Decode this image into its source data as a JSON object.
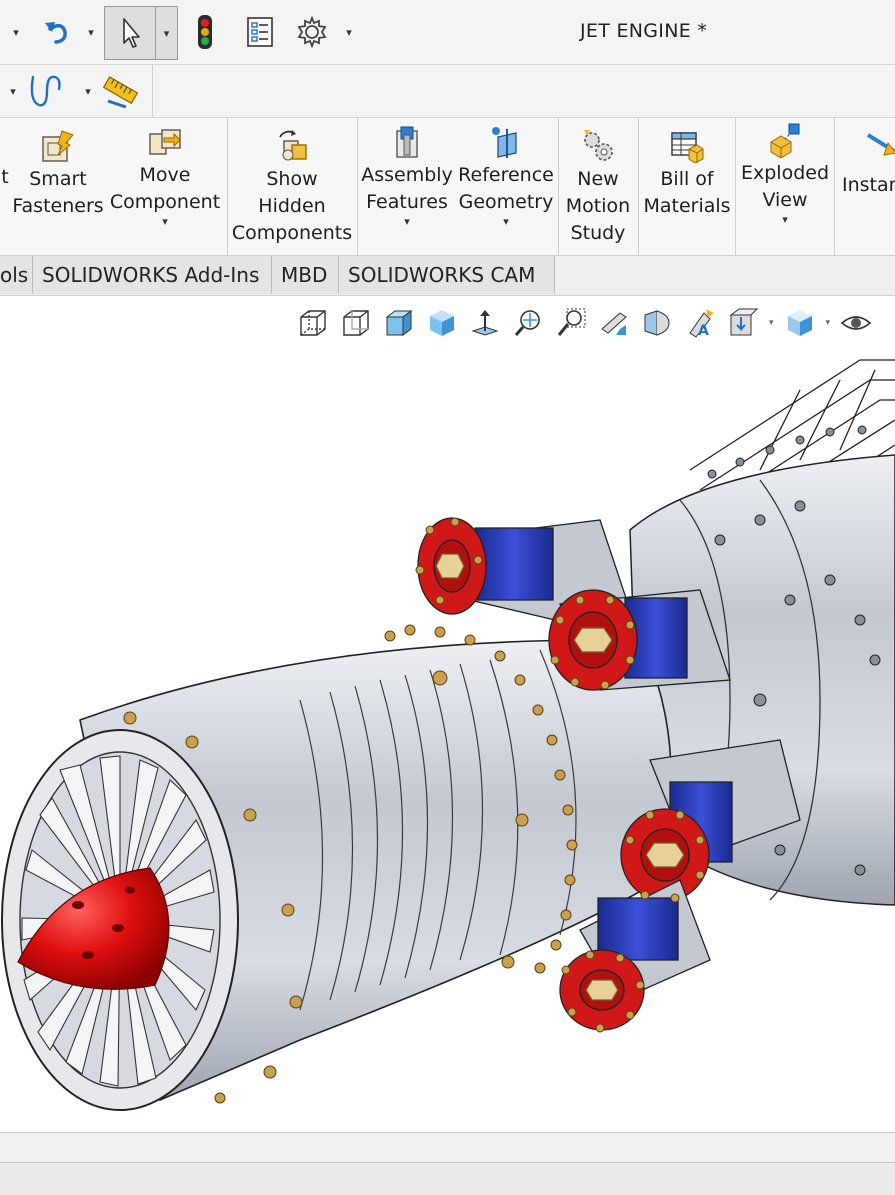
{
  "window": {
    "title": "JET ENGINE *"
  },
  "quick_access": {
    "icons": [
      "caret-down-icon",
      "undo-icon",
      "select-arrow-icon",
      "traffic-light-icon",
      "file-properties-icon",
      "options-gear-icon"
    ]
  },
  "sketch_row": {
    "icons": [
      "spline-icon",
      "measure-icon"
    ]
  },
  "ribbon": {
    "buttons": [
      {
        "label": "t",
        "icon": "partial-icon"
      },
      {
        "label": "Smart\nFasteners",
        "icon": "smart-fasteners-icon"
      },
      {
        "label": "Move\nComponent",
        "icon": "move-component-icon"
      },
      {
        "label": "Show\nHidden\nComponents",
        "icon": "show-hidden-icon"
      },
      {
        "label": "Assembly\nFeatures",
        "icon": "assembly-features-icon"
      },
      {
        "label": "Reference\nGeometry",
        "icon": "reference-geometry-icon"
      },
      {
        "label": "New\nMotion\nStudy",
        "icon": "motion-study-icon"
      },
      {
        "label": "Bill of\nMaterials",
        "icon": "bill-of-materials-icon"
      },
      {
        "label": "Exploded\nView",
        "icon": "exploded-view-icon"
      },
      {
        "label": "Instan",
        "icon": "instant3d-icon"
      }
    ]
  },
  "tabs": [
    {
      "label": "ols"
    },
    {
      "label": "SOLIDWORKS Add-Ins"
    },
    {
      "label": "MBD"
    },
    {
      "label": "SOLIDWORKS CAM"
    }
  ],
  "view_toolbar": {
    "icons": [
      "view-wireframe-icon",
      "view-hidden-lines-icon",
      "view-shaded-edges-icon",
      "view-shaded-icon",
      "view-normal-to-icon",
      "zoom-to-fit-icon",
      "zoom-to-area-icon",
      "previous-view-icon",
      "section-view-icon",
      "dynamic-annotation-icon",
      "view-orientation-icon",
      "display-style-icon",
      "hide-show-icon"
    ]
  },
  "model": {
    "name": "jet-engine-assembly",
    "colors": {
      "body": "#c9ced6",
      "spinner": "#e01010",
      "accent_red": "#d81818",
      "accent_blue": "#2438b8",
      "bolt": "#c8a050"
    }
  }
}
